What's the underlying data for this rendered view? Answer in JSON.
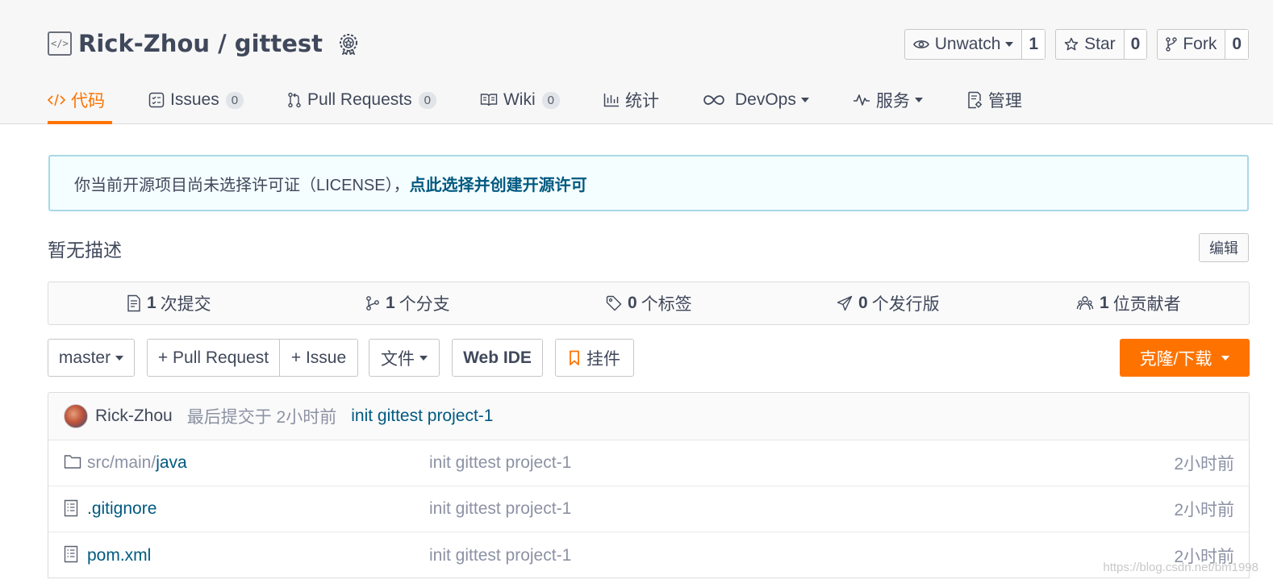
{
  "repo": {
    "title": "Rick-Zhou / gittest",
    "icon": "code-icon",
    "badge_icon": "award-icon"
  },
  "actions": [
    {
      "label": "Unwatch",
      "count": "1",
      "icon": "eye-icon"
    },
    {
      "label": "Star",
      "count": "0",
      "icon": "star-icon"
    },
    {
      "label": "Fork",
      "count": "0",
      "icon": "fork-icon"
    }
  ],
  "tabs": [
    {
      "label": "代码",
      "icon": "code-icon",
      "active": true
    },
    {
      "label": "Issues",
      "badge": "0",
      "icon": "issues-icon"
    },
    {
      "label": "Pull Requests",
      "badge": "0",
      "icon": "pull-request-icon"
    },
    {
      "label": "Wiki",
      "badge": "0",
      "icon": "book-icon"
    },
    {
      "label": "统计",
      "icon": "bar-chart-icon"
    },
    {
      "label": "DevOps",
      "icon": "infinity-icon"
    },
    {
      "label": "服务",
      "icon": "pulse-icon"
    },
    {
      "label": "管理",
      "icon": "settings-doc-icon"
    }
  ],
  "notice": {
    "text": "你当前开源项目尚未选择许可证（LICENSE），",
    "link": "点此选择并创建开源许可"
  },
  "description": {
    "text": "暂无描述",
    "edit_label": "编辑"
  },
  "stats": [
    {
      "count": "1",
      "label": "次提交",
      "icon": "commit-icon"
    },
    {
      "count": "1",
      "label": "个分支",
      "icon": "branch-icon"
    },
    {
      "count": "0",
      "label": "个标签",
      "icon": "tag-icon"
    },
    {
      "count": "0",
      "label": "个发行版",
      "icon": "release-icon"
    },
    {
      "count": "1",
      "label": "位贡献者",
      "icon": "contributors-icon"
    }
  ],
  "toolbar": {
    "branch": "master",
    "pull_request": "+ Pull Request",
    "issue": "+ Issue",
    "files": "文件",
    "web_ide": "Web IDE",
    "widgets": "挂件",
    "clone": "克隆/下载"
  },
  "last_commit": {
    "author": "Rick-Zhou",
    "time": "最后提交于 2小时前",
    "message": "init gittest project-1"
  },
  "files": [
    {
      "path_prefix": "src/main/",
      "name": "java",
      "message": "init gittest project-1",
      "time": "2小时前",
      "icon": "folder-icon"
    },
    {
      "path_prefix": "",
      "name": ".gitignore",
      "message": "init gittest project-1",
      "time": "2小时前",
      "icon": "file-icon"
    },
    {
      "path_prefix": "",
      "name": "pom.xml",
      "message": "init gittest project-1",
      "time": "2小时前",
      "icon": "file-icon"
    }
  ],
  "watermark": "https://blog.csdn.net/bm1998",
  "colors": {
    "accent": "#fe7300",
    "link": "#005980",
    "notice_border": "#a9d8e5"
  }
}
